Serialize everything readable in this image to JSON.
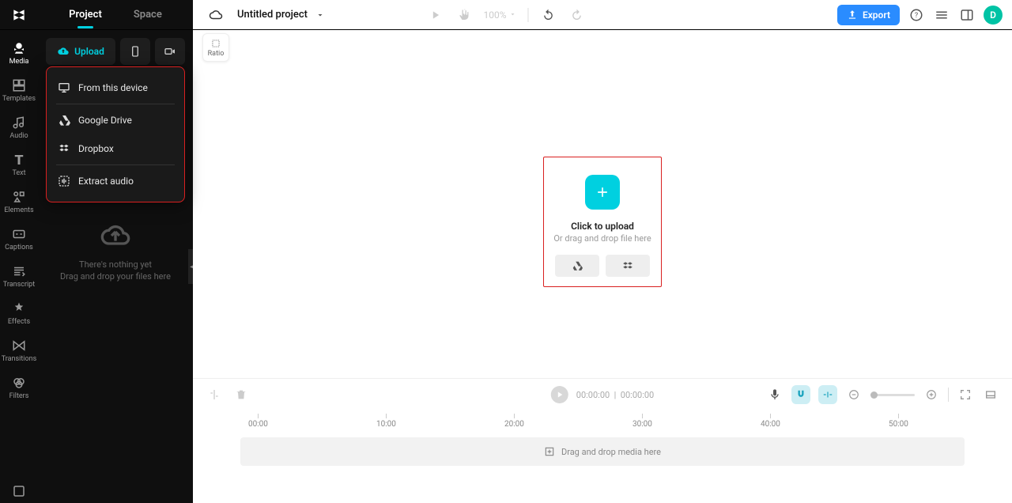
{
  "header": {
    "tabs": {
      "project": "Project",
      "space": "Space"
    },
    "project_title": "Untitled project",
    "zoom": "100%",
    "export_label": "Export",
    "avatar_letter": "D"
  },
  "rail": {
    "media": "Media",
    "templates": "Templates",
    "audio": "Audio",
    "text": "Text",
    "elements": "Elements",
    "captions": "Captions",
    "transcript": "Transcript",
    "effects": "Effects",
    "transitions": "Transitions",
    "filters": "Filters"
  },
  "sidepanel": {
    "upload_label": "Upload",
    "dropdown": {
      "device": "From this device",
      "gdrive": "Google Drive",
      "dropbox": "Dropbox",
      "extract": "Extract audio"
    },
    "empty_line1": "There's nothing yet",
    "empty_line2": "Drag and drop your files here"
  },
  "canvas": {
    "ratio_label": "Ratio",
    "upload_title": "Click to upload",
    "upload_sub": "Or drag and drop file here"
  },
  "timeline": {
    "time_current": "00:00:00",
    "time_total": "00:00:00",
    "ticks": [
      "00:00",
      "10:00",
      "20:00",
      "30:00",
      "40:00",
      "50:00"
    ],
    "drop_hint": "Drag and drop media here"
  }
}
